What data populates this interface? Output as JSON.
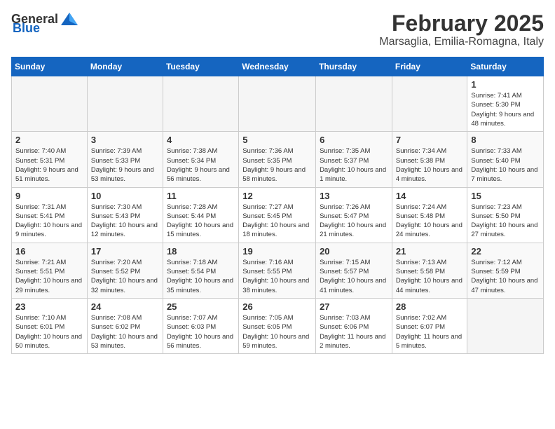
{
  "header": {
    "logo_general": "General",
    "logo_blue": "Blue",
    "month_title": "February 2025",
    "location": "Marsaglia, Emilia-Romagna, Italy"
  },
  "weekdays": [
    "Sunday",
    "Monday",
    "Tuesday",
    "Wednesday",
    "Thursday",
    "Friday",
    "Saturday"
  ],
  "weeks": [
    [
      {
        "day": "",
        "info": ""
      },
      {
        "day": "",
        "info": ""
      },
      {
        "day": "",
        "info": ""
      },
      {
        "day": "",
        "info": ""
      },
      {
        "day": "",
        "info": ""
      },
      {
        "day": "",
        "info": ""
      },
      {
        "day": "1",
        "info": "Sunrise: 7:41 AM\nSunset: 5:30 PM\nDaylight: 9 hours and 48 minutes."
      }
    ],
    [
      {
        "day": "2",
        "info": "Sunrise: 7:40 AM\nSunset: 5:31 PM\nDaylight: 9 hours and 51 minutes."
      },
      {
        "day": "3",
        "info": "Sunrise: 7:39 AM\nSunset: 5:33 PM\nDaylight: 9 hours and 53 minutes."
      },
      {
        "day": "4",
        "info": "Sunrise: 7:38 AM\nSunset: 5:34 PM\nDaylight: 9 hours and 56 minutes."
      },
      {
        "day": "5",
        "info": "Sunrise: 7:36 AM\nSunset: 5:35 PM\nDaylight: 9 hours and 58 minutes."
      },
      {
        "day": "6",
        "info": "Sunrise: 7:35 AM\nSunset: 5:37 PM\nDaylight: 10 hours and 1 minute."
      },
      {
        "day": "7",
        "info": "Sunrise: 7:34 AM\nSunset: 5:38 PM\nDaylight: 10 hours and 4 minutes."
      },
      {
        "day": "8",
        "info": "Sunrise: 7:33 AM\nSunset: 5:40 PM\nDaylight: 10 hours and 7 minutes."
      }
    ],
    [
      {
        "day": "9",
        "info": "Sunrise: 7:31 AM\nSunset: 5:41 PM\nDaylight: 10 hours and 9 minutes."
      },
      {
        "day": "10",
        "info": "Sunrise: 7:30 AM\nSunset: 5:43 PM\nDaylight: 10 hours and 12 minutes."
      },
      {
        "day": "11",
        "info": "Sunrise: 7:28 AM\nSunset: 5:44 PM\nDaylight: 10 hours and 15 minutes."
      },
      {
        "day": "12",
        "info": "Sunrise: 7:27 AM\nSunset: 5:45 PM\nDaylight: 10 hours and 18 minutes."
      },
      {
        "day": "13",
        "info": "Sunrise: 7:26 AM\nSunset: 5:47 PM\nDaylight: 10 hours and 21 minutes."
      },
      {
        "day": "14",
        "info": "Sunrise: 7:24 AM\nSunset: 5:48 PM\nDaylight: 10 hours and 24 minutes."
      },
      {
        "day": "15",
        "info": "Sunrise: 7:23 AM\nSunset: 5:50 PM\nDaylight: 10 hours and 27 minutes."
      }
    ],
    [
      {
        "day": "16",
        "info": "Sunrise: 7:21 AM\nSunset: 5:51 PM\nDaylight: 10 hours and 29 minutes."
      },
      {
        "day": "17",
        "info": "Sunrise: 7:20 AM\nSunset: 5:52 PM\nDaylight: 10 hours and 32 minutes."
      },
      {
        "day": "18",
        "info": "Sunrise: 7:18 AM\nSunset: 5:54 PM\nDaylight: 10 hours and 35 minutes."
      },
      {
        "day": "19",
        "info": "Sunrise: 7:16 AM\nSunset: 5:55 PM\nDaylight: 10 hours and 38 minutes."
      },
      {
        "day": "20",
        "info": "Sunrise: 7:15 AM\nSunset: 5:57 PM\nDaylight: 10 hours and 41 minutes."
      },
      {
        "day": "21",
        "info": "Sunrise: 7:13 AM\nSunset: 5:58 PM\nDaylight: 10 hours and 44 minutes."
      },
      {
        "day": "22",
        "info": "Sunrise: 7:12 AM\nSunset: 5:59 PM\nDaylight: 10 hours and 47 minutes."
      }
    ],
    [
      {
        "day": "23",
        "info": "Sunrise: 7:10 AM\nSunset: 6:01 PM\nDaylight: 10 hours and 50 minutes."
      },
      {
        "day": "24",
        "info": "Sunrise: 7:08 AM\nSunset: 6:02 PM\nDaylight: 10 hours and 53 minutes."
      },
      {
        "day": "25",
        "info": "Sunrise: 7:07 AM\nSunset: 6:03 PM\nDaylight: 10 hours and 56 minutes."
      },
      {
        "day": "26",
        "info": "Sunrise: 7:05 AM\nSunset: 6:05 PM\nDaylight: 10 hours and 59 minutes."
      },
      {
        "day": "27",
        "info": "Sunrise: 7:03 AM\nSunset: 6:06 PM\nDaylight: 11 hours and 2 minutes."
      },
      {
        "day": "28",
        "info": "Sunrise: 7:02 AM\nSunset: 6:07 PM\nDaylight: 11 hours and 5 minutes."
      },
      {
        "day": "",
        "info": ""
      }
    ]
  ]
}
